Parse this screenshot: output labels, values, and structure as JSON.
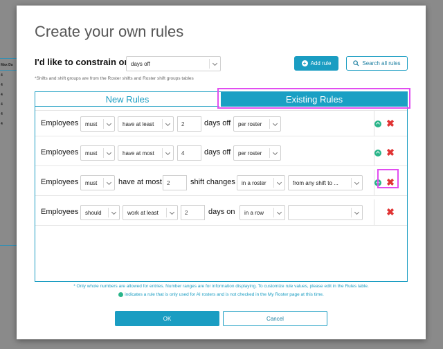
{
  "background": {
    "header_label": "Max Da",
    "row_values": [
      "4",
      "4",
      "4",
      "4",
      "4",
      "4"
    ]
  },
  "modal": {
    "title": "Create your own rules",
    "constrain_label": "I'd like to constrain on",
    "constrain_value": "days off",
    "add_rule_label": "Add rule",
    "search_rules_label": "Search all rules",
    "hint": "*Shifts and shift groups are from the Roster shifts and Roster shift groups tables",
    "tabs": {
      "new": "New Rules",
      "existing": "Existing Rules"
    },
    "rules": [
      {
        "subject": "Employees",
        "modal_verb": "must",
        "operator": "have at least",
        "amount": "2",
        "unit": "days off",
        "scope": "per roster"
      },
      {
        "subject": "Employees",
        "modal_verb": "must",
        "operator": "have at most",
        "amount": "4",
        "unit": "days off",
        "scope": "per roster"
      },
      {
        "subject": "Employees",
        "modal_verb": "must",
        "operator": "have at most",
        "amount": "2",
        "unit": "shift changes",
        "scope": "in a roster",
        "extra": "from any shift to ..."
      },
      {
        "subject": "Employees",
        "modal_verb": "should",
        "operator": "work at least",
        "amount": "2",
        "unit": "days on",
        "scope": "in a row",
        "extra": ""
      }
    ],
    "footer_note_1": "* Only whole numbers are allowed for entries. Number ranges are for information displaying. To customize rule values, please edit in the Rules table.",
    "footer_note_2": "indicates a rule that is only used for AI rosters and is not checked in the My Roster page at this time.",
    "ok_label": "OK",
    "cancel_label": "Cancel"
  },
  "colors": {
    "accent": "#1a9dc2",
    "delete": "#e03333",
    "ai_rule": "#2ab58a",
    "highlight": "#e14df0"
  },
  "icons": {
    "add": "plus-circle-icon",
    "search": "search-icon",
    "ai_rule": "leaf-up-icon",
    "delete": "close-icon"
  }
}
